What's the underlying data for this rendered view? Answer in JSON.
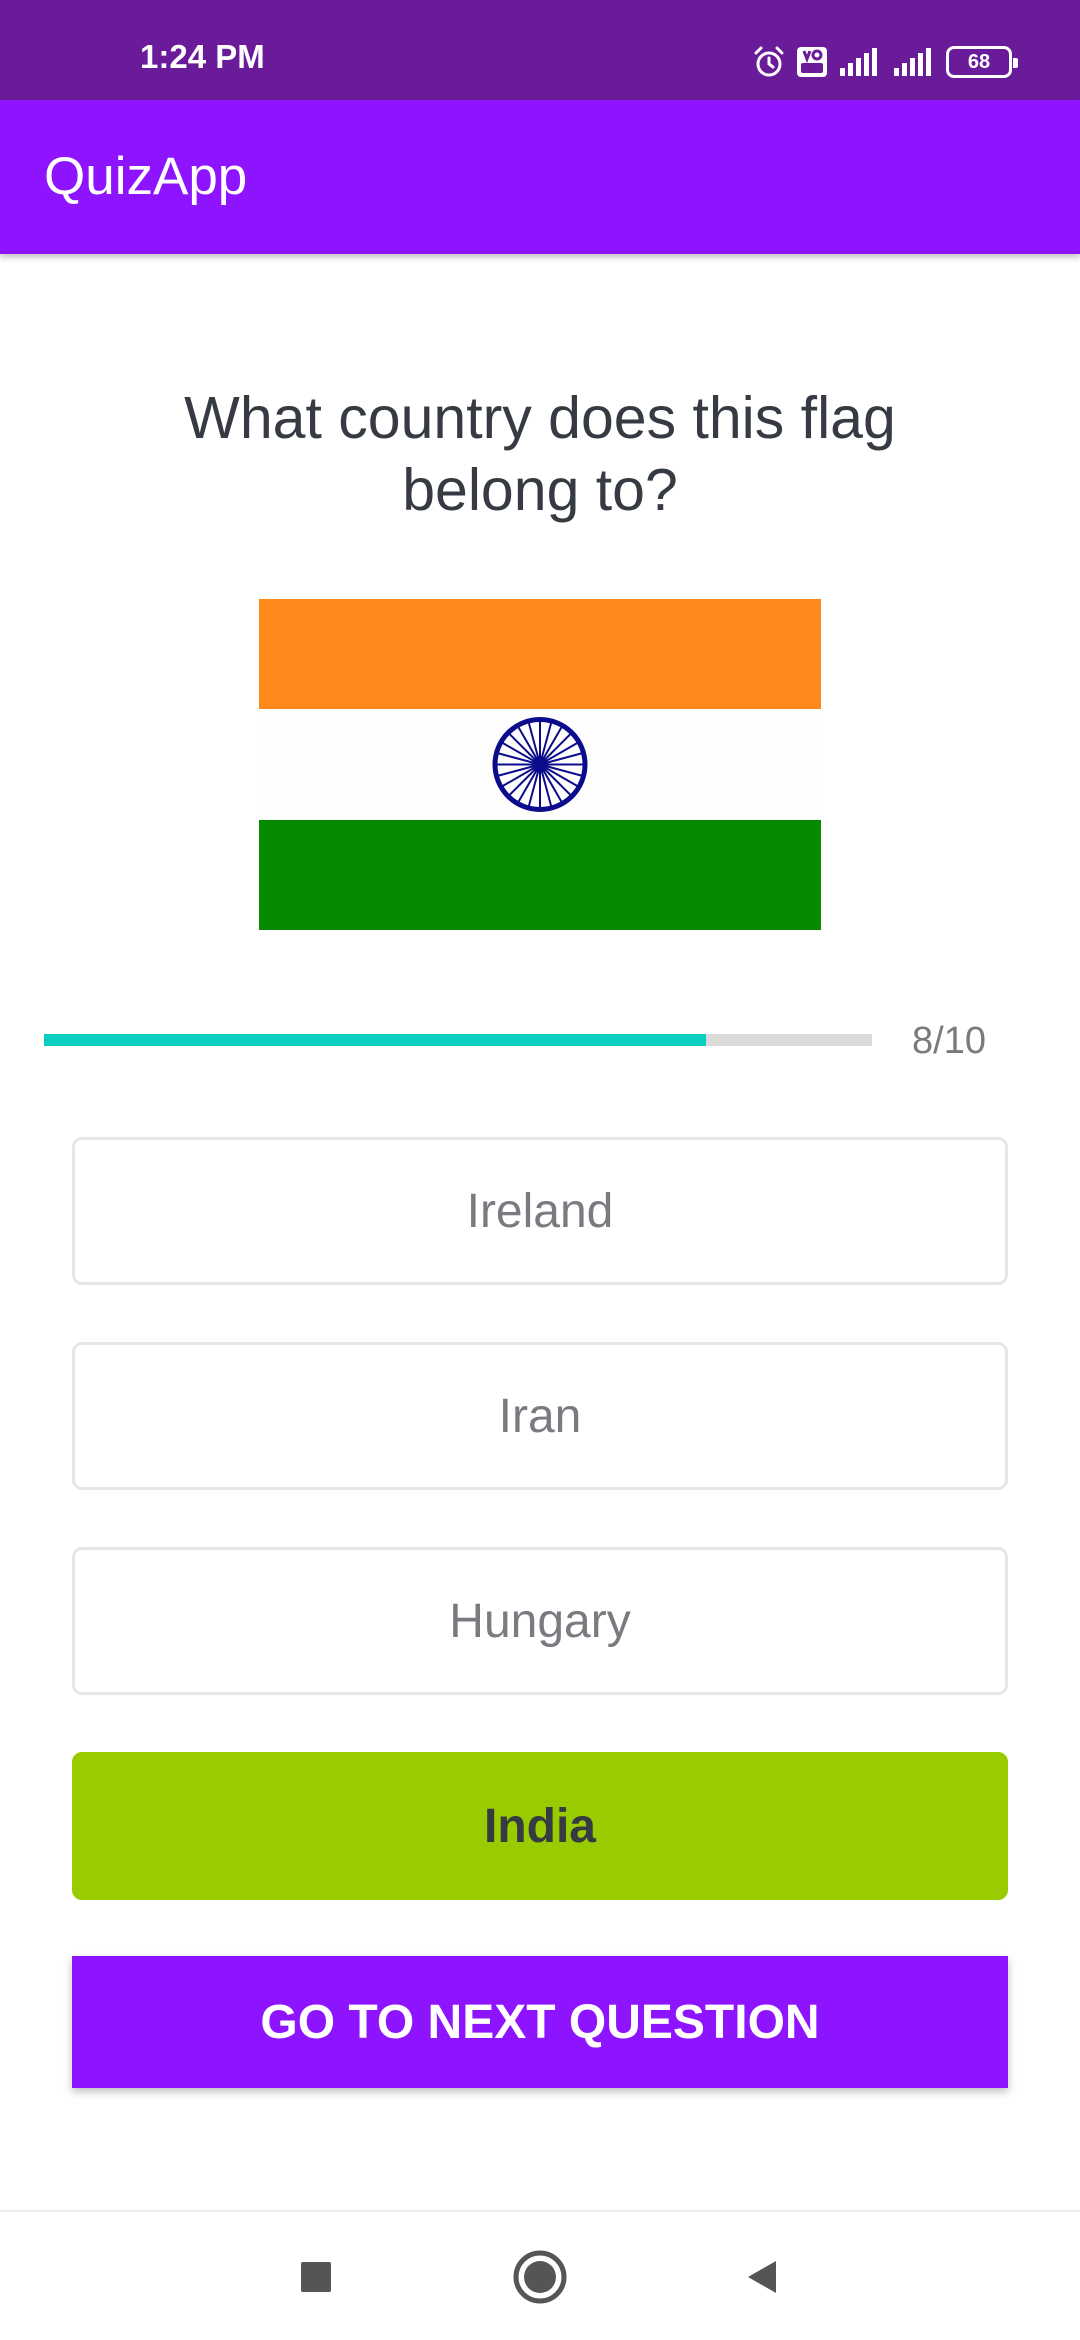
{
  "status_bar": {
    "time": "1:24 PM",
    "battery_level": "68",
    "color": "#6a1b9a"
  },
  "app_bar": {
    "title": "QuizApp",
    "color": "#8e13fe"
  },
  "question": {
    "text": "What country does this flag belong to?"
  },
  "flag": {
    "icon": "india-flag",
    "colors": {
      "saffron": "#ff881b",
      "white": "#fefefe",
      "green": "#058a00",
      "chakra": "#0b0c8b"
    }
  },
  "progress": {
    "current": 8,
    "max": 10,
    "text": "8/10",
    "fill_color": "#0acfc0",
    "track_color": "#dadada"
  },
  "options": [
    {
      "label": "Ireland",
      "state": "default"
    },
    {
      "label": "Iran",
      "state": "default"
    },
    {
      "label": "Hungary",
      "state": "default"
    },
    {
      "label": "India",
      "state": "correct"
    }
  ],
  "colors": {
    "correct": "#98cb00",
    "accent": "#8e13fe"
  },
  "next_button": {
    "label": "GO TO NEXT QUESTION"
  },
  "nav_bar": {
    "icons": [
      "recents-square-icon",
      "home-circle-icon",
      "back-triangle-icon"
    ]
  }
}
